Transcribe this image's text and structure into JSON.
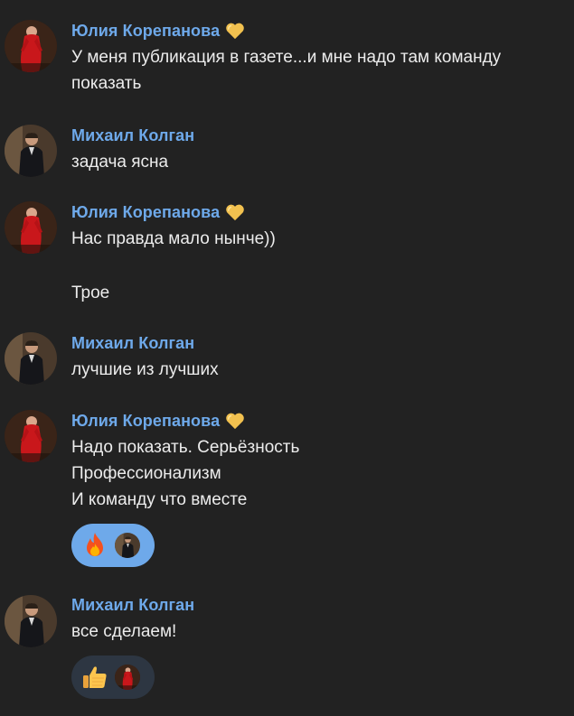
{
  "messages": [
    {
      "author": "Юлия Корепанова",
      "avatar": "avatar-yulia",
      "badge": "yellow-heart-icon",
      "lines": [
        "У меня публикация в газете...и мне надо там команду",
        "показать"
      ]
    },
    {
      "author": "Михаил Колган",
      "avatar": "avatar-mikhail",
      "lines": [
        "задача ясна"
      ]
    },
    {
      "author": "Юлия Корепанова",
      "avatar": "avatar-yulia",
      "badge": "yellow-heart-icon",
      "lines": [
        "Нас правда мало нынче))",
        "Трое"
      ]
    },
    {
      "author": "Михаил Колган",
      "avatar": "avatar-mikhail",
      "lines": [
        "лучшие из лучших"
      ]
    },
    {
      "author": "Юлия Корепанова",
      "avatar": "avatar-yulia",
      "badge": "yellow-heart-icon",
      "lines": [
        "Надо показать. Серьёзность",
        "Профессионализм",
        "И команду что вместе"
      ],
      "reaction": {
        "emoji": "fire-icon",
        "by": "avatar-mikhail",
        "style": "mine"
      }
    },
    {
      "author": "Михаил Колган",
      "avatar": "avatar-mikhail",
      "lines": [
        "все сделаем!"
      ],
      "reaction": {
        "emoji": "thumbs-up-icon",
        "by": "avatar-yulia",
        "style": "other"
      }
    }
  ],
  "colors": {
    "background": "#222222",
    "author_name": "#6ea9ea",
    "text": "#ececec",
    "reaction_mine": "#6ea9ea",
    "reaction_other": "#2d3642"
  }
}
